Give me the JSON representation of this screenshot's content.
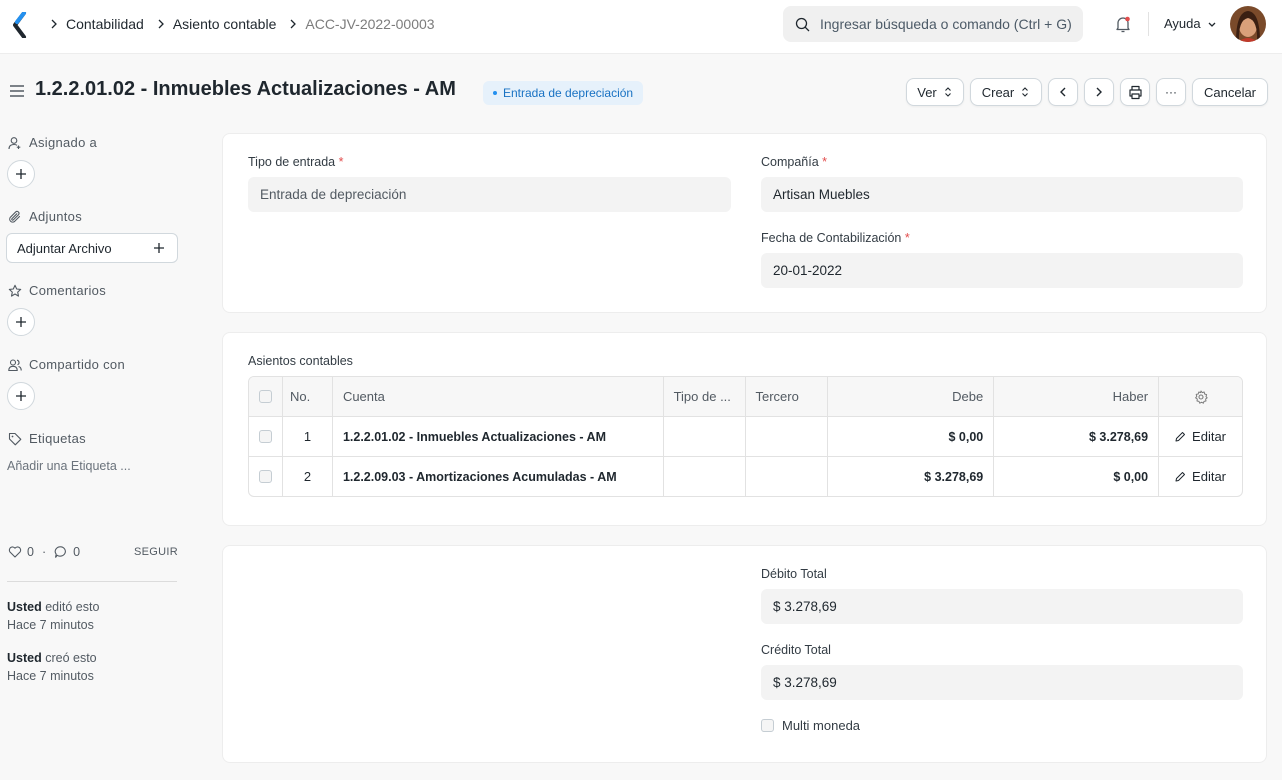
{
  "navbar": {
    "breadcrumbs": [
      "Contabilidad",
      "Asiento contable",
      "ACC-JV-2022-00003"
    ],
    "search_placeholder": "Ingresar búsqueda o comando (Ctrl + G)",
    "help_label": "Ayuda"
  },
  "header": {
    "title": "1.2.2.01.02 - Inmuebles Actualizaciones - AM",
    "status": "Entrada de depreciación",
    "view_label": "Ver",
    "create_label": "Crear",
    "more_label": "···",
    "cancel_label": "Cancelar"
  },
  "sidebar": {
    "assigned_label": "Asignado a",
    "attachments_label": "Adjuntos",
    "attach_button": "Adjuntar Archivo",
    "comments_label": "Comentarios",
    "shared_label": "Compartido con",
    "tags_label": "Etiquetas",
    "add_tag": "Añadir una Etiqueta ...",
    "likes": "0",
    "comments_count": "0",
    "follow": "SEGUIR",
    "activity": [
      {
        "user": "Usted",
        "action": " editó esto",
        "time": "Hace 7 minutos"
      },
      {
        "user": "Usted",
        "action": " creó esto",
        "time": "Hace 7 minutos"
      }
    ]
  },
  "form": {
    "entry_type_label": "Tipo de entrada",
    "entry_type_value": "Entrada de depreciación",
    "company_label": "Compañía",
    "company_value": "Artisan Muebles",
    "posting_date_label": "Fecha de Contabilización",
    "posting_date_value": "20-01-2022"
  },
  "accounts": {
    "section_label": "Asientos contables",
    "columns": {
      "no": "No.",
      "account": "Cuenta",
      "party_type": "Tipo de ...",
      "party": "Tercero",
      "debit": "Debe",
      "credit": "Haber"
    },
    "rows": [
      {
        "no": "1",
        "account": "1.2.2.01.02 - Inmuebles Actualizaciones - AM",
        "party_type": "",
        "party": "",
        "debit": "$ 0,00",
        "credit": "$ 3.278,69",
        "edit": "Editar"
      },
      {
        "no": "2",
        "account": "1.2.2.09.03 - Amortizaciones Acumuladas - AM",
        "party_type": "",
        "party": "",
        "debit": "$ 3.278,69",
        "credit": "$ 0,00",
        "edit": "Editar"
      }
    ]
  },
  "totals": {
    "total_debit_label": "Débito Total",
    "total_debit_value": "$ 3.278,69",
    "total_credit_label": "Crédito Total",
    "total_credit_value": "$ 3.278,69",
    "multi_currency_label": "Multi moneda"
  },
  "colors": {
    "accent": "#2490ef",
    "status_bg": "#e6f1fb",
    "status_text": "#1972c3",
    "required": "#e24c4c"
  }
}
